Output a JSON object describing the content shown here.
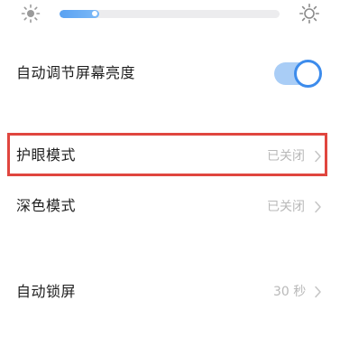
{
  "brightness": {
    "level_percent": 18,
    "accent_color": "#5aa2f2"
  },
  "auto_brightness": {
    "label": "自动调节屏幕亮度",
    "enabled": true
  },
  "eye_care": {
    "label": "护眼模式",
    "value": "已关闭",
    "highlight_color": "#e0463f"
  },
  "dark_mode": {
    "label": "深色模式",
    "value": "已关闭"
  },
  "auto_lock": {
    "label": "自动锁屏",
    "value": "30 秒"
  }
}
